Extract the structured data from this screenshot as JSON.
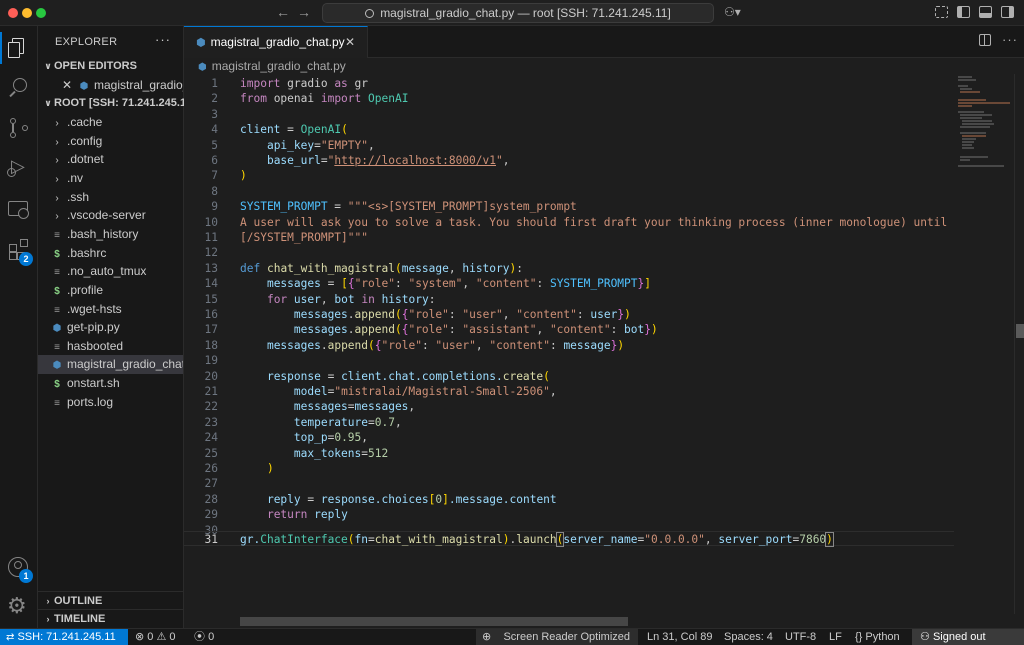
{
  "titlebar": {
    "command_center": "magistral_gradio_chat.py — root [SSH: 71.241.245.11]"
  },
  "activity_badges": {
    "extensions": "2",
    "accounts": "1"
  },
  "sidebar": {
    "title": "EXPLORER",
    "more": "···",
    "open_editors_label": "OPEN EDITORS",
    "open_editor_file": "magistral_gradio_chat.py",
    "root_label": "ROOT [SSH: 71.241.245.11]",
    "items": [
      {
        "name": ".cache",
        "type": "folder"
      },
      {
        "name": ".config",
        "type": "folder"
      },
      {
        "name": ".dotnet",
        "type": "folder"
      },
      {
        "name": ".nv",
        "type": "folder"
      },
      {
        "name": ".ssh",
        "type": "folder"
      },
      {
        "name": ".vscode-server",
        "type": "folder"
      },
      {
        "name": ".bash_history",
        "type": "file"
      },
      {
        "name": ".bashrc",
        "type": "shell"
      },
      {
        "name": ".no_auto_tmux",
        "type": "file"
      },
      {
        "name": ".profile",
        "type": "shell"
      },
      {
        "name": ".wget-hsts",
        "type": "file"
      },
      {
        "name": "get-pip.py",
        "type": "python"
      },
      {
        "name": "hasbooted",
        "type": "file"
      },
      {
        "name": "magistral_gradio_chat.py",
        "type": "python"
      },
      {
        "name": "onstart.sh",
        "type": "shell"
      },
      {
        "name": "ports.log",
        "type": "file"
      }
    ],
    "outline_label": "OUTLINE",
    "timeline_label": "TIMELINE"
  },
  "editor": {
    "tab_label": "magistral_gradio_chat.py",
    "breadcrumb": "magistral_gradio_chat.py",
    "current_line": 31,
    "line_numbers": [
      "1",
      "2",
      "3",
      "4",
      "5",
      "6",
      "7",
      "8",
      "9",
      "10",
      "11",
      "12",
      "13",
      "14",
      "15",
      "16",
      "17",
      "18",
      "19",
      "20",
      "21",
      "22",
      "23",
      "24",
      "25",
      "26",
      "27",
      "28",
      "29",
      "30",
      "31"
    ],
    "code_text": {
      "l1_import": "import",
      "l1_mod": " gradio ",
      "l1_as": "as",
      "l1_alias": " gr",
      "l2_from": "from",
      "l2_mod": " openai ",
      "l2_import": "import",
      "l2_cls": "OpenAI",
      "l4_var": "client",
      "l4_eq": " = ",
      "l4_cls": "OpenAI",
      "l5_kw": "api_key",
      "l5_str": "\"EMPTY\"",
      "l6_kw": "base_url",
      "l6_q1": "\"",
      "l6_url": "http://localhost:8000/v1",
      "l6_q2": "\"",
      "l9_const": "SYSTEM_PROMPT",
      "l9_str": "\"\"\"<s>[SYSTEM_PROMPT]system_prompt",
      "l10_str": "A user will ask you to solve a task. You should first draft your thinking process (inner monologue) until you have derived the final answer.",
      "l11_str": "[/SYSTEM_PROMPT]\"\"\"",
      "l13_def": "def",
      "l13_fn": "chat_with_magistral",
      "l13_p1": "message",
      "l13_p2": "history",
      "l14_var": "messages",
      "l14_k1": "\"role\"",
      "l14_v1": "\"system\"",
      "l14_k2": "\"content\"",
      "l14_c": "SYSTEM_PROMPT",
      "l15_for": "for",
      "l15_user": "user",
      "l15_bot": "bot",
      "l15_in": "in",
      "l15_hist": "history",
      "l16_var": "messages",
      "l16_fn": "append",
      "l16_k1": "\"role\"",
      "l16_v1": "\"user\"",
      "l16_k2": "\"content\"",
      "l16_v2": "user",
      "l17_var": "messages",
      "l17_fn": "append",
      "l17_k1": "\"role\"",
      "l17_v1": "\"assistant\"",
      "l17_k2": "\"content\"",
      "l17_v2": "bot",
      "l18_var": "messages",
      "l18_fn": "append",
      "l18_k1": "\"role\"",
      "l18_v1": "\"user\"",
      "l18_k2": "\"content\"",
      "l18_v2": "message",
      "l20_var": "response",
      "l20_chain": "client.chat.completions.",
      "l20_fn": "create",
      "l21_kw": "model",
      "l21_str": "\"mistralai/Magistral-Small-2506\"",
      "l22_kw": "messages",
      "l22_val": "messages",
      "l23_kw": "temperature",
      "l23_num": "0.7",
      "l24_kw": "top_p",
      "l24_num": "0.95",
      "l25_kw": "max_tokens",
      "l25_num": "512",
      "l28_var": "reply",
      "l28_chain": "response.choices",
      "l28_num": "0",
      "l28_tail": ".message.content",
      "l29_ret": "return",
      "l29_var": "reply",
      "l31_gr": "gr.",
      "l31_cls": "ChatInterface",
      "l31_fnkw": "fn",
      "l31_fnval": "chat_with_magistral",
      "l31_launch": "launch",
      "l31_sn": "server_name",
      "l31_snv": "\"0.0.0.0\"",
      "l31_sp": "server_port",
      "l31_spv": "7860"
    }
  },
  "statusbar": {
    "remote": "SSH: 71.241.245.11",
    "errors": "0",
    "warnings": "0",
    "ports": "0",
    "screen_reader": "Screen Reader Optimized",
    "position": "Ln 31, Col 89",
    "spaces": "Spaces: 4",
    "encoding": "UTF-8",
    "eol": "LF",
    "language": "Python",
    "account": "Signed out"
  }
}
